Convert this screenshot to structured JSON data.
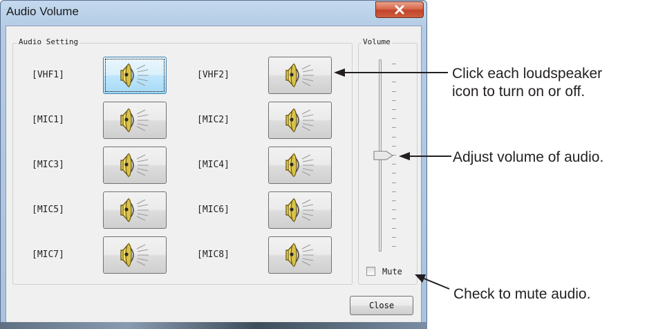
{
  "window": {
    "title": "Audio Volume",
    "close_icon": "close-x-icon"
  },
  "audio_setting": {
    "group_label": "Audio Setting",
    "channels": [
      {
        "label": "[VHF1]",
        "icon": "loudspeaker-icon",
        "focused": true
      },
      {
        "label": "[VHF2]",
        "icon": "loudspeaker-icon",
        "focused": false
      },
      {
        "label": "[MIC1]",
        "icon": "loudspeaker-icon",
        "focused": false
      },
      {
        "label": "[MIC2]",
        "icon": "loudspeaker-icon",
        "focused": false
      },
      {
        "label": "[MIC3]",
        "icon": "loudspeaker-icon",
        "focused": false
      },
      {
        "label": "[MIC4]",
        "icon": "loudspeaker-icon",
        "focused": false
      },
      {
        "label": "[MIC5]",
        "icon": "loudspeaker-icon",
        "focused": false
      },
      {
        "label": "[MIC6]",
        "icon": "loudspeaker-icon",
        "focused": false
      },
      {
        "label": "[MIC7]",
        "icon": "loudspeaker-icon",
        "focused": false
      },
      {
        "label": "[MIC8]",
        "icon": "loudspeaker-icon",
        "focused": false
      }
    ]
  },
  "volume": {
    "group_label": "Volume",
    "mute_label": "Mute",
    "mute_checked": false
  },
  "close_button": "Close",
  "annotations": {
    "speaker_line1": "Click each loudspeaker",
    "speaker_line2": "icon to turn on or off.",
    "volume": "Adjust volume of audio.",
    "mute": "Check to mute audio."
  }
}
